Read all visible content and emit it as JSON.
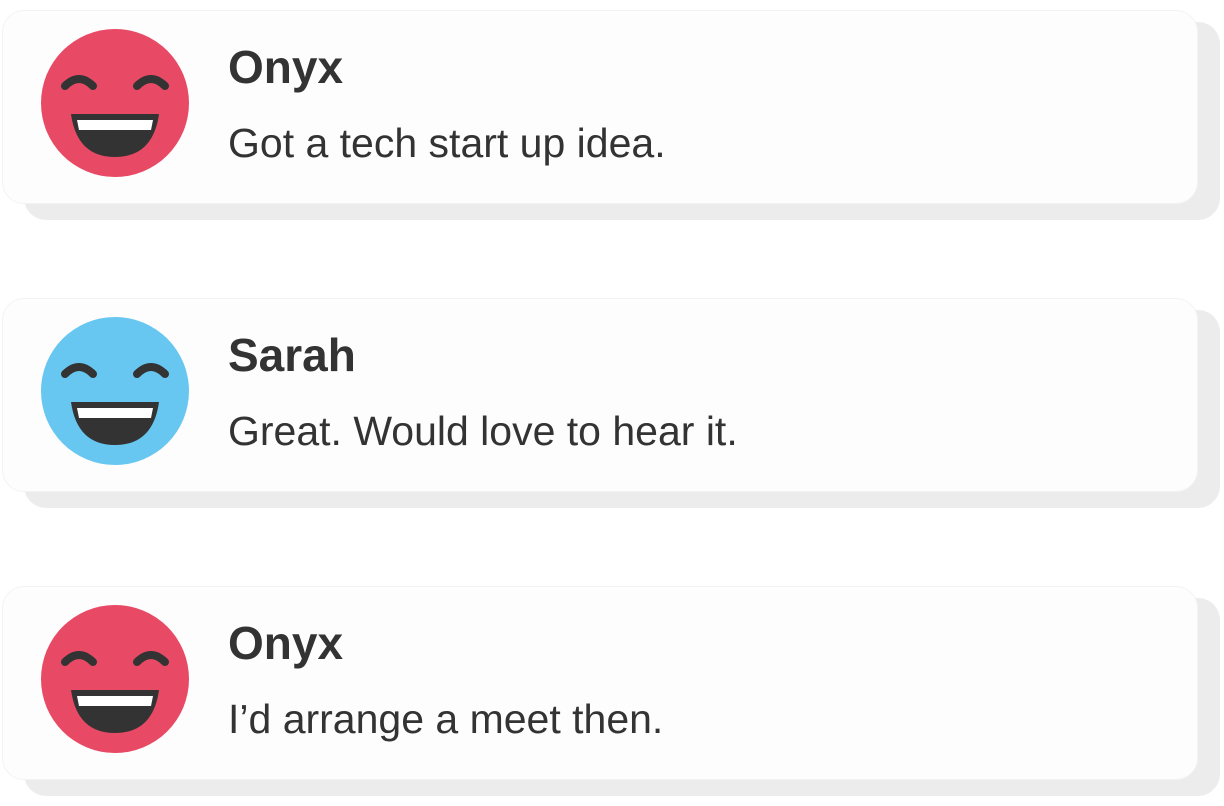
{
  "messages": [
    {
      "sender": "Onyx",
      "text": "Got a tech start up idea.",
      "avatar_icon": "laughing-face-icon",
      "avatar_color": "#e84a66"
    },
    {
      "sender": "Sarah",
      "text": "Great. Would love to hear it.",
      "avatar_icon": "laughing-face-icon",
      "avatar_color": "#67c7f1"
    },
    {
      "sender": "Onyx",
      "text": "I’d arrange a meet then.",
      "avatar_icon": "laughing-face-icon",
      "avatar_color": "#e84a66"
    }
  ],
  "colors": {
    "text": "#333333",
    "face_features": "#333333",
    "teeth": "#ffffff",
    "card_background": "#fdfdfd",
    "card_shadow": "#ececec"
  }
}
